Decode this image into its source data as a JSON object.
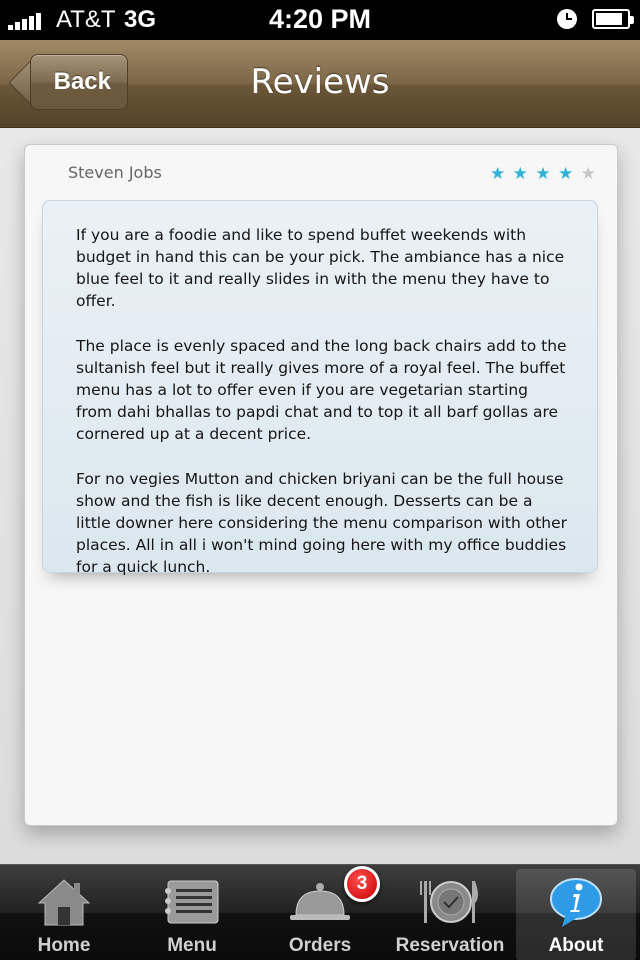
{
  "status_bar": {
    "carrier": "AT&T",
    "network": "3G",
    "time": "4:20 PM"
  },
  "nav_bar": {
    "back_label": "Back",
    "title": "Reviews"
  },
  "review": {
    "reviewer": "Steven Jobs",
    "rating": 4,
    "rating_max": 5,
    "paragraphs": [
      "If you are a foodie and like to spend buffet weekends with budget in hand this can be your pick. The ambiance has a nice blue feel to it and really slides in with the menu they have to offer.",
      "The place is evenly spaced and the long back chairs add to the sultanish feel but it really gives more of a royal feel. The buffet menu has a lot to offer even if you are vegetarian starting from dahi bhallas to papdi chat and to top it all barf gollas are cornered up at a decent price.",
      "For no vegies Mutton and chicken briyani can be the full house show and the fish is like decent enough. Desserts can be a little downer here considering the menu comparison with other places. All in all i won't mind going here with my office buddies for a quick lunch."
    ],
    "star_colors": {
      "on": "#2fb3d6",
      "off": "#c7c7c7"
    }
  },
  "tab_bar": {
    "tabs": [
      {
        "label": "Home",
        "icon": "home-icon"
      },
      {
        "label": "Menu",
        "icon": "menu-icon"
      },
      {
        "label": "Orders",
        "icon": "cloche-icon"
      },
      {
        "label": "Reservation",
        "icon": "plate-icon"
      },
      {
        "label": "About",
        "icon": "info-icon"
      }
    ],
    "active": "About",
    "orders_badge": "3"
  }
}
